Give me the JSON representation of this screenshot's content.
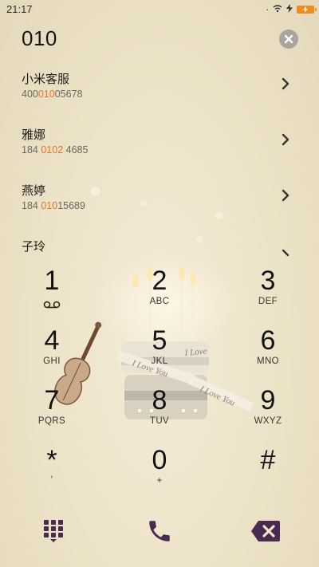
{
  "status_bar": {
    "time": "21:17",
    "icons": [
      "signal-dots-icon",
      "wifi-off-icon",
      "charging-icon",
      "battery-icon"
    ],
    "battery_color": "#f28b1e"
  },
  "dialer": {
    "entered_number": "010",
    "clear_icon": "clear-circle-icon"
  },
  "contacts": [
    {
      "name": "小米客服",
      "number_pre": "400",
      "number_match": "010",
      "number_post": "05678"
    },
    {
      "name": "雅娜",
      "number_pre": "184 ",
      "number_match": "0102",
      "number_post": " 4685"
    },
    {
      "name": "燕婷",
      "number_pre": "184 ",
      "number_match": "010",
      "number_post": "15689"
    },
    {
      "name": "子玲",
      "number_pre": "",
      "number_match": "",
      "number_post": ""
    }
  ],
  "keypad": {
    "keys": [
      {
        "digit": "1",
        "letters": ""
      },
      {
        "digit": "2",
        "letters": "ABC"
      },
      {
        "digit": "3",
        "letters": "DEF"
      },
      {
        "digit": "4",
        "letters": "GHI"
      },
      {
        "digit": "5",
        "letters": "JKL"
      },
      {
        "digit": "6",
        "letters": "MNO"
      },
      {
        "digit": "7",
        "letters": "PQRS"
      },
      {
        "digit": "8",
        "letters": "TUV"
      },
      {
        "digit": "9",
        "letters": "WXYZ"
      },
      {
        "digit": "*",
        "letters": ","
      },
      {
        "digit": "0",
        "letters": "+"
      },
      {
        "digit": "#",
        "letters": ""
      }
    ]
  },
  "bottom_bar": {
    "icons": [
      "dialpad-icon",
      "call-icon",
      "backspace-icon"
    ],
    "accent_color": "#4a2a4f"
  },
  "background_text": {
    "ribbon_1": "I Love You",
    "ribbon_2": "I Love You",
    "ribbon_3": "I Love"
  },
  "colors": {
    "match_highlight": "#e8742c"
  }
}
